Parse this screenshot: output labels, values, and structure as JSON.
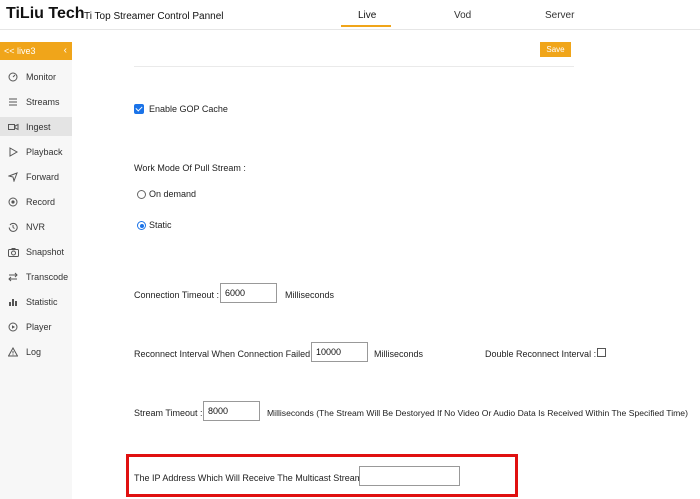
{
  "header": {
    "brand": "TiLiu Tech",
    "subtitle": "Ti Top Streamer Control Pannel",
    "tabs": [
      {
        "label": "Live",
        "active": true
      },
      {
        "label": "Vod",
        "active": false
      },
      {
        "label": "Server",
        "active": false
      }
    ]
  },
  "sidebar": {
    "header": "<< live3",
    "items": [
      {
        "label": "Monitor",
        "icon": "gauge-icon"
      },
      {
        "label": "Streams",
        "icon": "list-icon"
      },
      {
        "label": "Ingest",
        "icon": "video-camera-icon",
        "active": true
      },
      {
        "label": "Playback",
        "icon": "play-icon"
      },
      {
        "label": "Forward",
        "icon": "send-icon"
      },
      {
        "label": "Record",
        "icon": "record-icon"
      },
      {
        "label": "NVR",
        "icon": "history-icon"
      },
      {
        "label": "Snapshot",
        "icon": "camera-icon"
      },
      {
        "label": "Transcode",
        "icon": "swap-icon"
      },
      {
        "label": "Statistic",
        "icon": "bar-chart-icon"
      },
      {
        "label": "Player",
        "icon": "play-circle-icon"
      },
      {
        "label": "Log",
        "icon": "warning-icon"
      }
    ]
  },
  "form": {
    "save_label": "Save",
    "gop_cache_label": "Enable GOP Cache",
    "gop_cache_checked": true,
    "pull_mode_label": "Work Mode Of Pull Stream :",
    "pull_mode_options": [
      {
        "label": "On demand",
        "checked": false
      },
      {
        "label": "Static",
        "checked": true
      }
    ],
    "connection_timeout_label": "Connection Timeout :",
    "connection_timeout_value": "6000",
    "connection_timeout_unit": "Milliseconds",
    "reconnect_interval_label": "Reconnect Interval When Connection Failed :",
    "reconnect_interval_value": "10000",
    "reconnect_interval_unit": "Milliseconds",
    "double_reconnect_label": "Double Reconnect Interval :",
    "double_reconnect_checked": false,
    "stream_timeout_label": "Stream Timeout :",
    "stream_timeout_value": "8000",
    "stream_timeout_unit": "Milliseconds (The Stream Will Be Destoryed If No Video Or Audio Data Is Received Within The Specified Time)",
    "multicast_ip_label": "The IP Address Which Will Receive The Multicast Stream :",
    "multicast_ip_value": ""
  },
  "colors": {
    "accent": "#f0a51a",
    "checkbox_blue": "#1a73e8",
    "highlight_red": "#e01010"
  }
}
